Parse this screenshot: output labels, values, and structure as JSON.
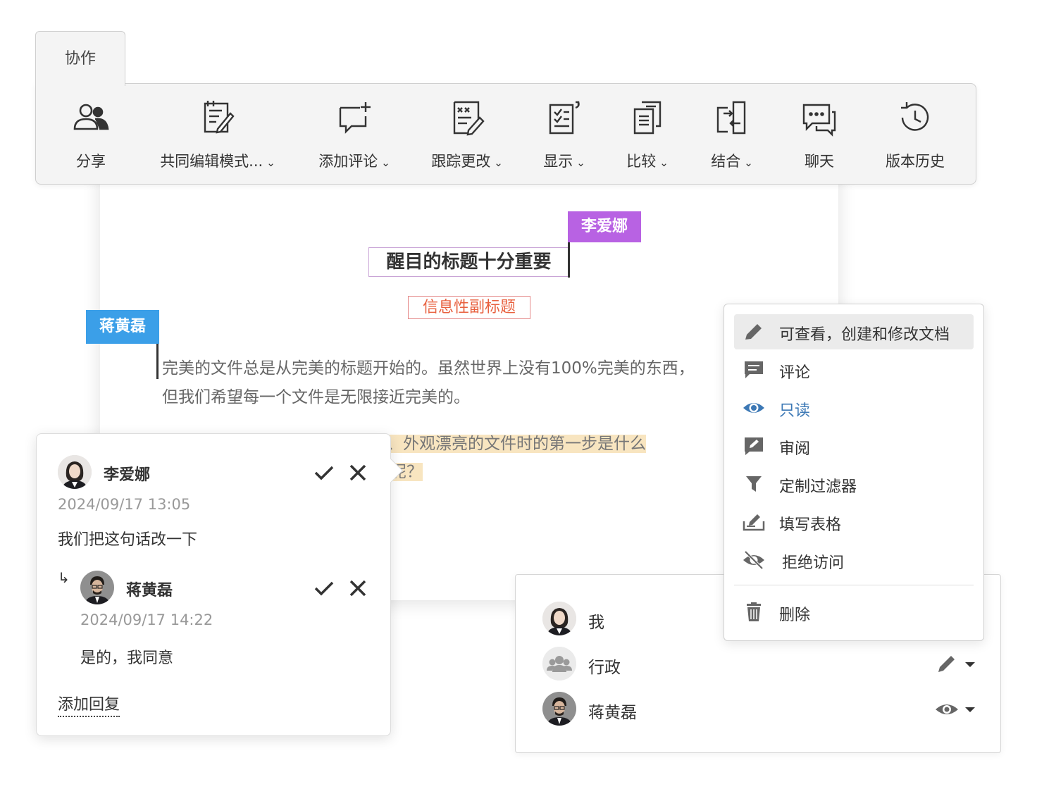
{
  "toolbar": {
    "tab_label": "协作",
    "items": [
      {
        "label": "分享",
        "icon": "share-users-icon",
        "dropdown": false
      },
      {
        "label": "共同编辑模式...",
        "icon": "co-editing-icon",
        "dropdown": true
      },
      {
        "label": "添加评论",
        "icon": "add-comment-icon",
        "dropdown": true
      },
      {
        "label": "跟踪更改",
        "icon": "track-changes-icon",
        "dropdown": true
      },
      {
        "label": "显示",
        "icon": "display-icon",
        "dropdown": true
      },
      {
        "label": "比较",
        "icon": "compare-icon",
        "dropdown": true
      },
      {
        "label": "结合",
        "icon": "combine-icon",
        "dropdown": true
      },
      {
        "label": "聊天",
        "icon": "chat-icon",
        "dropdown": false
      },
      {
        "label": "版本历史",
        "icon": "version-history-icon",
        "dropdown": false
      }
    ]
  },
  "document": {
    "title": "醒目的标题十分重要",
    "subtitle": "信息性副标题",
    "paragraph1": "完美的文件总是从完美的标题开始的。虽然世界上没有100%完美的东西，",
    "paragraph1_line2": "但我们希望每一个文件是无限接近完美的。",
    "paragraph2_line1": "那么，当您需要起草一份结构良好、外观漂亮的文件时的第一步是什么",
    "paragraph2_line2": "呢？",
    "cursor_tags": [
      {
        "name": "李爱娜",
        "color": "#b862e3"
      },
      {
        "name": "蒋黄磊",
        "color": "#3b9fe8"
      }
    ]
  },
  "comment": {
    "author": "李爱娜",
    "time": "2024/09/17 13:05",
    "text": "我们把这句话改一下",
    "reply": {
      "author": "蒋黄磊",
      "time": "2024/09/17 14:22",
      "text": "是的，我同意"
    },
    "reply_arrow": "↳",
    "add_reply_label": "添加回复"
  },
  "share": {
    "users": [
      {
        "name": "我",
        "avatar": "female-avatar"
      },
      {
        "name": "行政",
        "avatar": "group-avatar",
        "permission_icon": "pencil-icon"
      },
      {
        "name": "蒋黄磊",
        "avatar": "male-avatar",
        "permission_icon": "eye-icon"
      }
    ]
  },
  "permission_menu": {
    "items": [
      {
        "label": "可查看，创建和修改文档",
        "icon": "pencil-icon",
        "active": true
      },
      {
        "label": "评论",
        "icon": "comment-icon"
      },
      {
        "label": "只读",
        "icon": "eye-icon",
        "selected": true
      },
      {
        "label": "审阅",
        "icon": "review-icon"
      },
      {
        "label": "定制过滤器",
        "icon": "filter-icon"
      },
      {
        "label": "填写表格",
        "icon": "fill-form-icon"
      },
      {
        "label": "拒绝访问",
        "icon": "eye-slash-icon"
      }
    ],
    "delete_label": "删除",
    "delete_icon": "trash-icon"
  },
  "colors": {
    "accent_purple": "#b862e3",
    "accent_blue": "#3b9fe8",
    "subtitle_red": "#e8613f",
    "highlight": "#f8e5c0",
    "selected_blue": "#3c78b5"
  }
}
